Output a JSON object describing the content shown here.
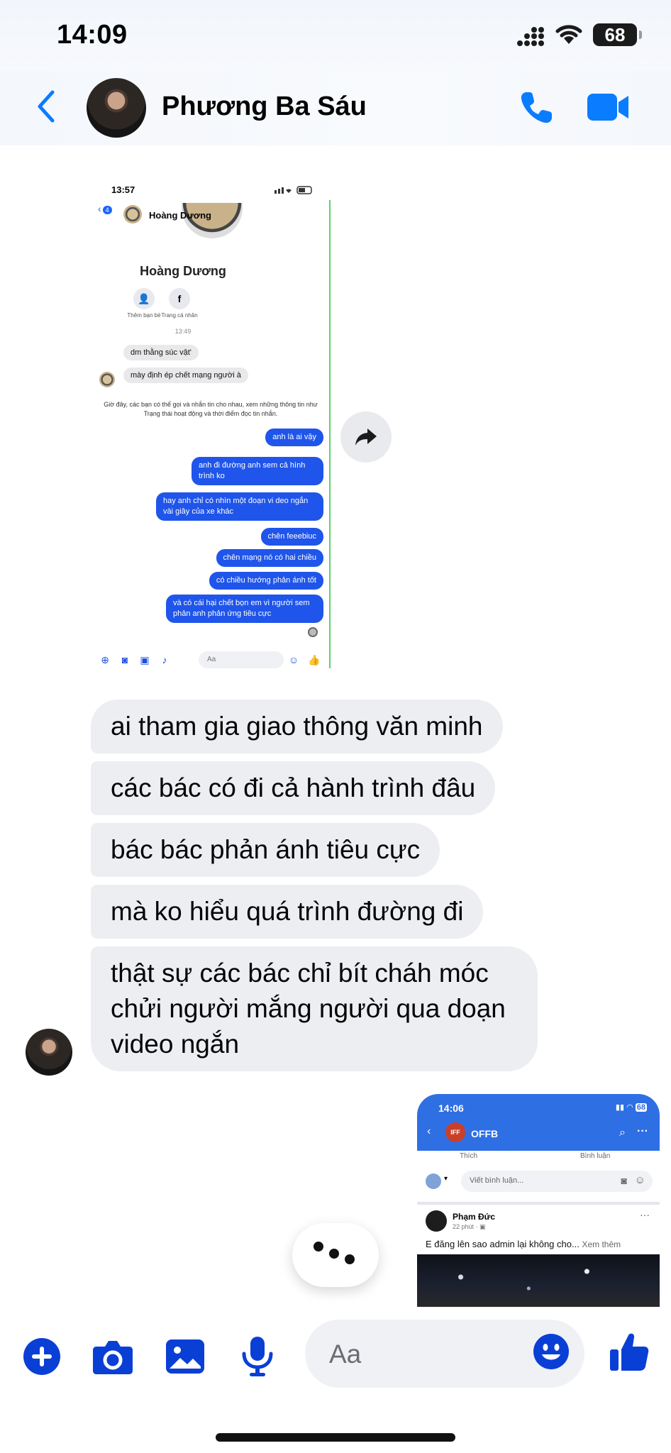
{
  "status_bar": {
    "time": "14:09",
    "battery": "68"
  },
  "header": {
    "contact_name": "Phương Ba Sáu"
  },
  "screenshot1": {
    "status_time": "13:57",
    "back_count": "4",
    "header_name": "Hoàng Dương",
    "profile_name": "Hoàng Dương",
    "action_add_label": "Thêm bạn bè",
    "action_profile_label": "Trang cá nhân",
    "timestamp": "13:49",
    "incoming": [
      "dm  thằng súc vật'",
      "mày  định ép chết  mạng người à"
    ],
    "notice": "Giờ đây, các bạn có thể gọi và nhắn tin cho nhau, xem những thông tin như Trạng thái hoạt động và thời điểm đọc tin nhắn.",
    "outgoing": [
      "anh là ai vậy",
      "anh đi đường anh sem cả hình trình ko",
      "hay anh chỉ có nhìn một đoạn vi deo ngắn vài giây của xe khác",
      "chên feeebiuc",
      "chên mạng nó có hai chiều",
      "có chiều hướng phản ánh tốt",
      "và có cái hại chết bọn em vì người sem phản anh phản ứng tiêu cực"
    ],
    "composer_placeholder": "Aa"
  },
  "messages_in": [
    "ai tham gia giao thông văn minh",
    "các bác có đi cả hành trình đâu",
    "bác bác phản ánh tiêu cực",
    "mà ko hiểu quá trình đường đi",
    "thật sự các bác chỉ bít cháh móc chửi người mắng người qua doạn video ngắn"
  ],
  "screenshot2": {
    "status_time": "14:06",
    "battery": "68",
    "page_logo": "IFF",
    "page_name": "OFFB",
    "like_label": "Thích",
    "comment_label": "Bình luận",
    "comment_placeholder": "Viết bình luận...",
    "post_author": "Phạm Đức",
    "post_time": "22 phút · ",
    "post_text": "E đăng lên sao admin lại không cho...",
    "see_more": "Xem thêm"
  },
  "composer": {
    "placeholder": "Aa"
  },
  "colors": {
    "accent": "#0a7cff",
    "bubble_in": "#eceef2",
    "outgoing_shot": "#1f55ea"
  }
}
